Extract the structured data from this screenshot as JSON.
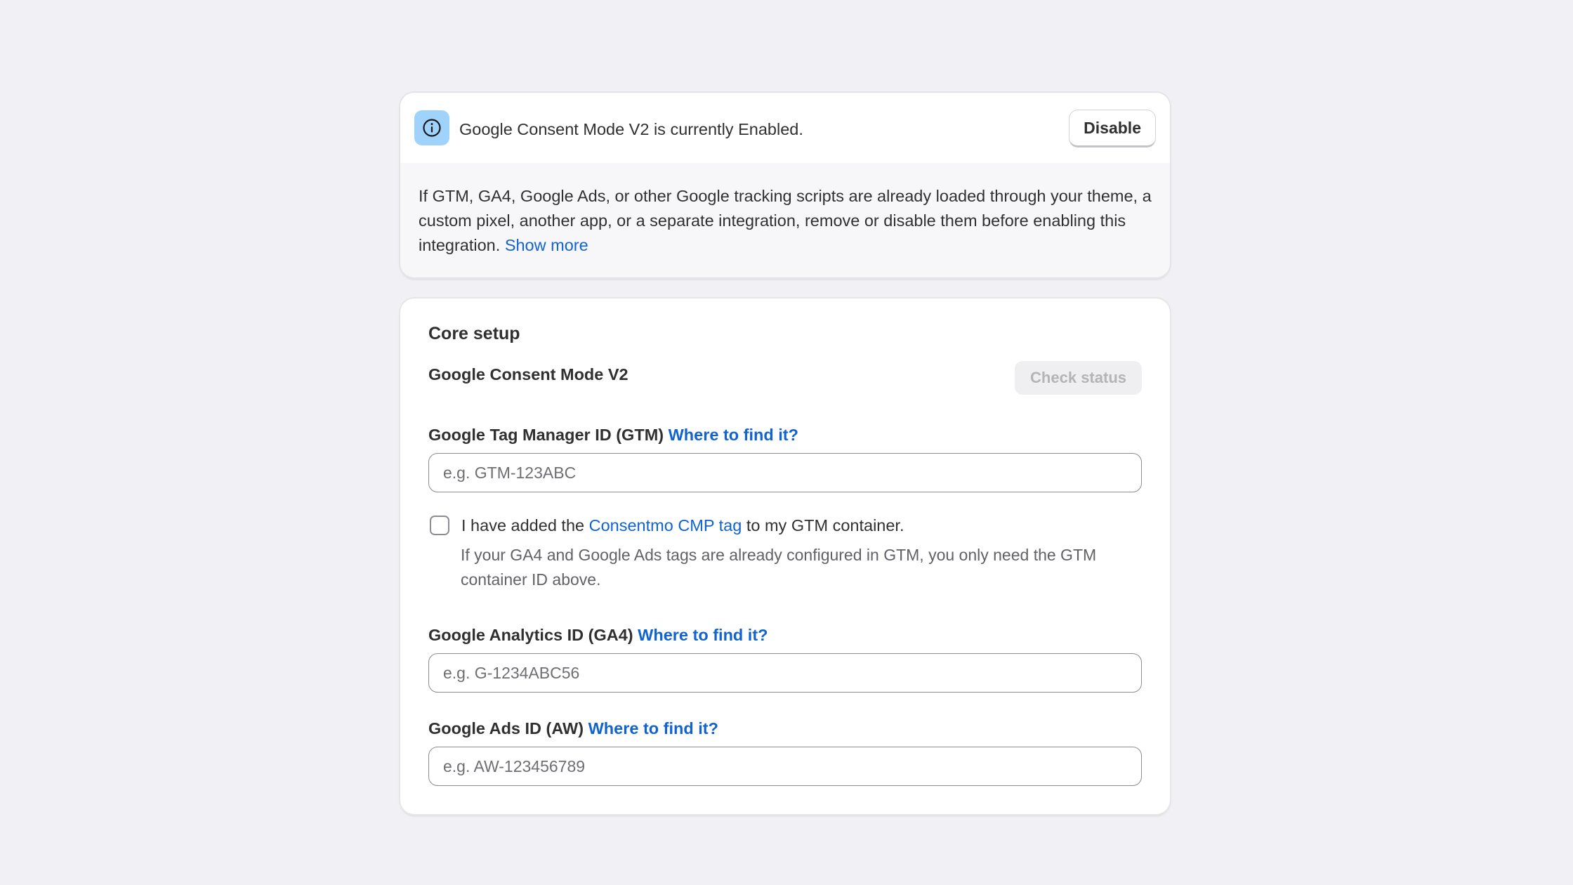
{
  "banner": {
    "icon": "info-icon",
    "title": "Google Consent Mode V2 is currently Enabled.",
    "disable_label": "Disable",
    "body_text": "If GTM, GA4, Google Ads, or other Google tracking scripts are already loaded through your theme, a custom pixel, another app, or a separate integration, remove or disable them before enabling this integration.",
    "show_more_label": "Show more"
  },
  "core": {
    "heading": "Core setup",
    "consent_mode_label": "Google Consent Mode V2",
    "check_status_label": "Check status",
    "gtm": {
      "label": "Google Tag Manager ID (GTM)",
      "help_link": "Where to find it?",
      "placeholder": "e.g. GTM-123ABC",
      "value": ""
    },
    "cmp_checkbox": {
      "checked": false,
      "text_before": "I have added the ",
      "link": "Consentmo CMP tag",
      "text_after": " to my GTM container.",
      "help": "If your GA4 and Google Ads tags are already configured in GTM, you only need the GTM container ID above."
    },
    "ga4": {
      "label": "Google Analytics ID (GA4)",
      "help_link": "Where to find it?",
      "placeholder": "e.g. G-1234ABC56",
      "value": ""
    },
    "aw": {
      "label": "Google Ads ID (AW)",
      "help_link": "Where to find it?",
      "placeholder": "e.g. AW-123456789",
      "value": ""
    }
  },
  "colors": {
    "background": "#f1f1f5",
    "link": "#1063d0",
    "info_badge": "#9fd3fb",
    "text": "#303030"
  }
}
